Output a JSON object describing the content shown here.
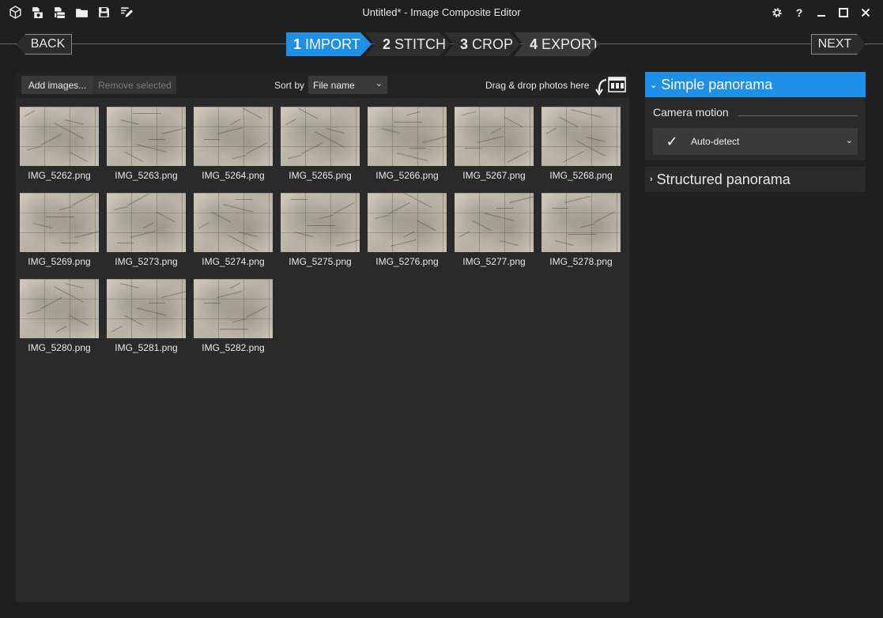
{
  "window": {
    "title": "Untitled* - Image Composite Editor",
    "toolbar_icons": [
      "new-panorama-icon",
      "new-from-video-icon",
      "new-from-images-icon",
      "open-project-icon",
      "save-project-icon",
      "rename-icon"
    ],
    "controls": [
      "settings-icon",
      "help-icon",
      "minimize-icon",
      "maximize-icon",
      "close-icon"
    ]
  },
  "nav": {
    "back_label": "BACK",
    "next_label": "NEXT",
    "steps": [
      {
        "num": "1",
        "label": "IMPORT"
      },
      {
        "num": "2",
        "label": "STITCH"
      },
      {
        "num": "3",
        "label": "CROP"
      },
      {
        "num": "4",
        "label": "EXPORT"
      }
    ]
  },
  "import_toolbar": {
    "add_label": "Add images...",
    "remove_label": "Remove selected",
    "sort_label": "Sort by",
    "sort_value": "File name",
    "drag_text": "Drag & drop photos here"
  },
  "images": [
    "IMG_5262.png",
    "IMG_5263.png",
    "IMG_5264.png",
    "IMG_5265.png",
    "IMG_5266.png",
    "IMG_5267.png",
    "IMG_5268.png",
    "IMG_5269.png",
    "IMG_5273.png",
    "IMG_5274.png",
    "IMG_5275.png",
    "IMG_5276.png",
    "IMG_5277.png",
    "IMG_5278.png",
    "IMG_5280.png",
    "IMG_5281.png",
    "IMG_5282.png"
  ],
  "panorama": {
    "simple_label": "Simple panorama",
    "camera_motion_label": "Camera motion",
    "camera_motion_value": "Auto-detect",
    "structured_label": "Structured panorama"
  },
  "colors": {
    "accent": "#1e90e8",
    "background": "#1f1f1f",
    "panel": "#2a2a2a"
  }
}
